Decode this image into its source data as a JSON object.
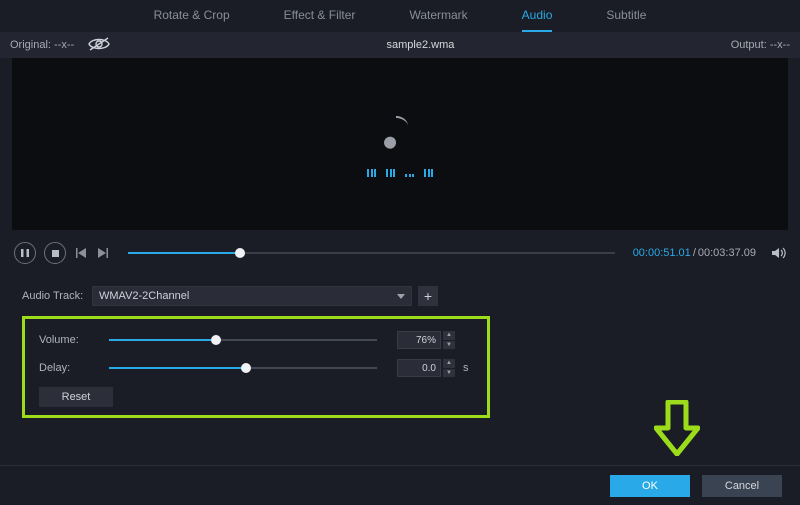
{
  "tabs": {
    "rotate_crop": "Rotate & Crop",
    "effect_filter": "Effect & Filter",
    "watermark": "Watermark",
    "audio": "Audio",
    "subtitle": "Subtitle"
  },
  "infobar": {
    "original_label": "Original:",
    "original_value": "--x--",
    "filename": "sample2.wma",
    "output_label": "Output:",
    "output_value": "--x--"
  },
  "timecode": {
    "current": "00:00:51.01",
    "sep": "/",
    "duration": "00:03:37.09"
  },
  "audio": {
    "track_label": "Audio Track:",
    "track_value": "WMAV2-2Channel",
    "volume_label": "Volume:",
    "volume_value": "76%",
    "volume_percent": 40,
    "delay_label": "Delay:",
    "delay_value": "0.0",
    "delay_unit": "s",
    "delay_percent": 51,
    "reset_label": "Reset"
  },
  "footer": {
    "ok": "OK",
    "cancel": "Cancel"
  }
}
